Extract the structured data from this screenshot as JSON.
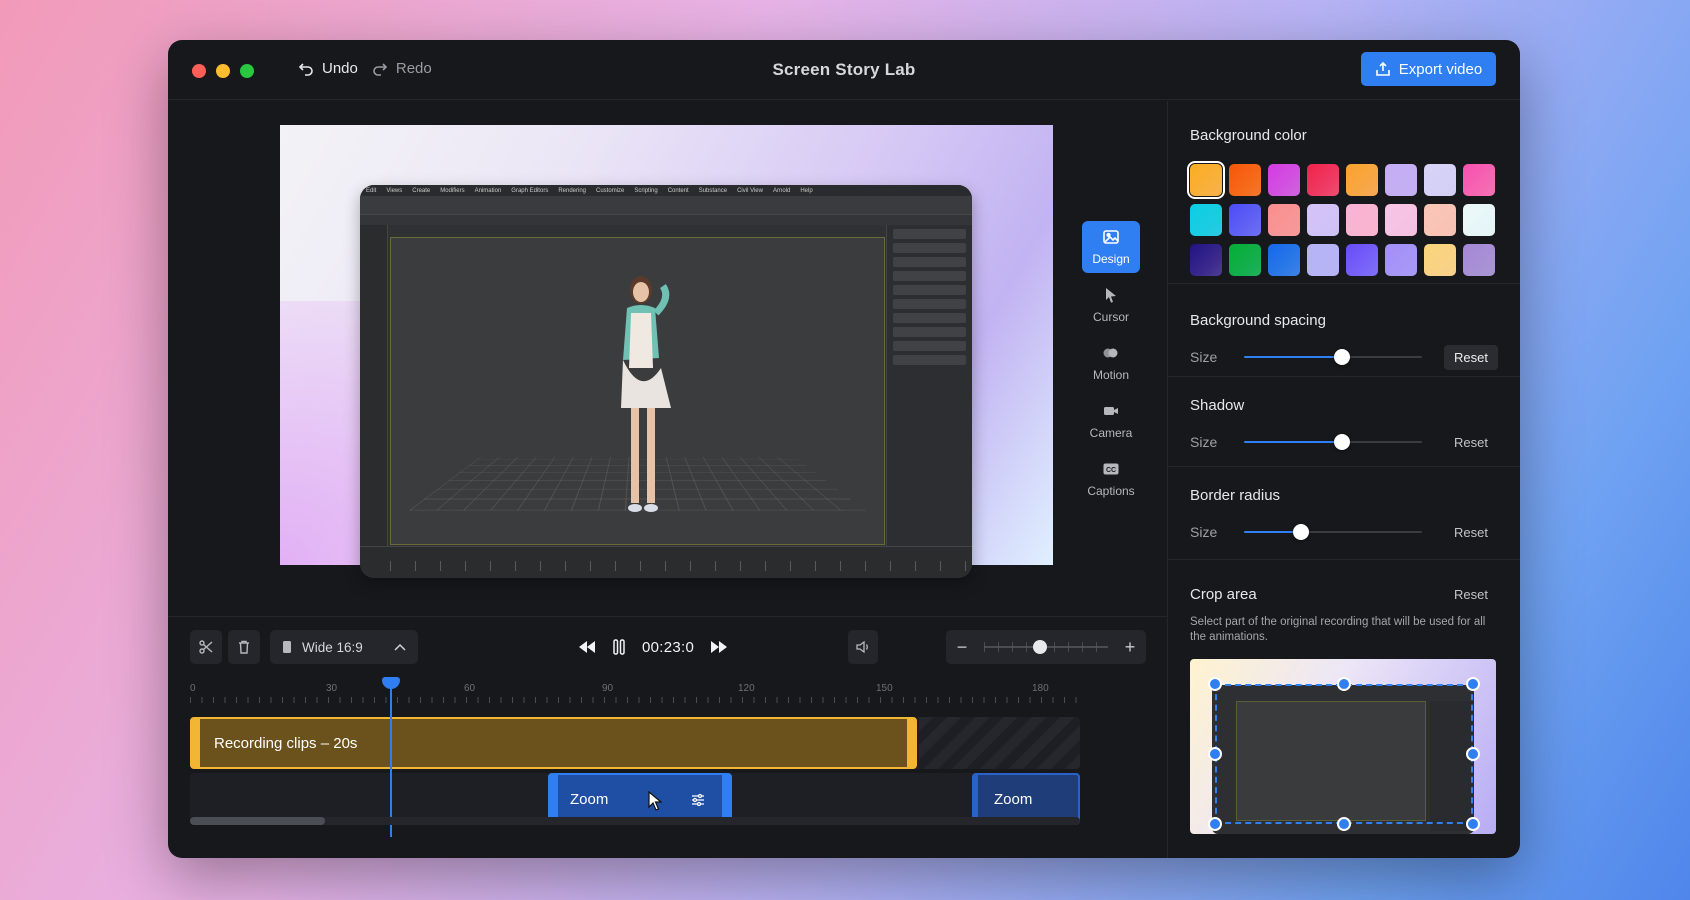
{
  "window": {
    "title": "Screen Story Lab"
  },
  "titlebar": {
    "undo_label": "Undo",
    "redo_label": "Redo",
    "export_label": "Export video"
  },
  "tools": [
    {
      "label": "Design",
      "icon": "image-icon",
      "active": true
    },
    {
      "label": "Cursor",
      "icon": "cursor-icon",
      "active": false
    },
    {
      "label": "Motion",
      "icon": "motion-icon",
      "active": false
    },
    {
      "label": "Camera",
      "icon": "camera-icon",
      "active": false
    },
    {
      "label": "Captions",
      "icon": "captions-icon",
      "active": false
    }
  ],
  "panel": {
    "background_color": {
      "title": "Background color",
      "swatches": [
        "#f7a33b",
        "#f2631c",
        "#c64fd6",
        "#e93a5c",
        "#f59a43",
        "#b8a2ee",
        "#c9c5f2",
        "#f25fa5",
        "#1ec0d8",
        "#5b5cf0",
        "#f58a8a",
        "#c5b5f3",
        "#f7a7c6",
        "#f1b6da",
        "#f5b7a8",
        "#dff3f5",
        "#3a2a82",
        "#15a24a",
        "#2c6fe0",
        "#a9a7f2",
        "#6e5cf5",
        "#9a8af3",
        "#f6c77b",
        "#9b85c9"
      ],
      "selected_index": 0
    },
    "background_spacing": {
      "title": "Background spacing",
      "size_label": "Size",
      "value": 0.55,
      "reset_label": "Reset"
    },
    "shadow": {
      "title": "Shadow",
      "size_label": "Size",
      "value": 0.55,
      "reset_label": "Reset"
    },
    "border_radius": {
      "title": "Border radius",
      "size_label": "Size",
      "value": 0.32,
      "reset_label": "Reset"
    },
    "crop_area": {
      "title": "Crop area",
      "reset_label": "Reset",
      "description": "Select part of the original recording that will be used for all the animations."
    }
  },
  "toolbar": {
    "aspect_label": "Wide 16:9",
    "time": "00:23:0",
    "zoom_level": 0.5
  },
  "timeline": {
    "ruler_labels": [
      "0",
      "30",
      "60",
      "90",
      "120",
      "150",
      "180"
    ],
    "recording_clip_label": "Recording clips – 20s",
    "zoom_clips": [
      {
        "label": "Zoom"
      },
      {
        "label": "Zoom"
      }
    ]
  },
  "preview": {
    "recording_menu": [
      "Edit",
      "Views",
      "Create",
      "Modifiers",
      "Animation",
      "Graph Editors",
      "Rendering",
      "Customize",
      "Scripting",
      "Content",
      "Substance",
      "Civil View",
      "Arnold",
      "Help"
    ]
  }
}
